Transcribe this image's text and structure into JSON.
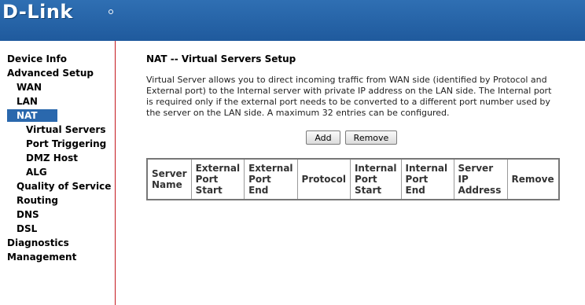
{
  "brand": {
    "logo_text": "D-Link"
  },
  "sidebar": {
    "items": [
      {
        "label": "Device Info"
      },
      {
        "label": "Advanced Setup"
      },
      {
        "label": "WAN"
      },
      {
        "label": "LAN"
      },
      {
        "label": "NAT"
      },
      {
        "label": "Virtual Servers"
      },
      {
        "label": "Port Triggering"
      },
      {
        "label": "DMZ Host"
      },
      {
        "label": "ALG"
      },
      {
        "label": "Quality of Service"
      },
      {
        "label": "Routing"
      },
      {
        "label": "DNS"
      },
      {
        "label": "DSL"
      },
      {
        "label": "Diagnostics"
      },
      {
        "label": "Management"
      }
    ],
    "active": "NAT"
  },
  "main": {
    "title": "NAT -- Virtual Servers Setup",
    "description": "Virtual Server allows you to direct incoming traffic from WAN side (identified by Protocol and External port) to the Internal server with private IP address on the LAN side. The Internal port is required only if the external port needs to be converted to a different port number used by the server on the LAN side. A maximum 32 entries can be configured.",
    "buttons": {
      "add": "Add",
      "remove": "Remove"
    },
    "table": {
      "columns": [
        "Server Name",
        "External Port Start",
        "External Port End",
        "Protocol",
        "Internal Port Start",
        "Internal Port End",
        "Server IP Address",
        "Remove"
      ]
    }
  },
  "colors": {
    "banner": "#2a68ad",
    "active_nav": "#2a68ad",
    "divider": "#c4181e"
  }
}
